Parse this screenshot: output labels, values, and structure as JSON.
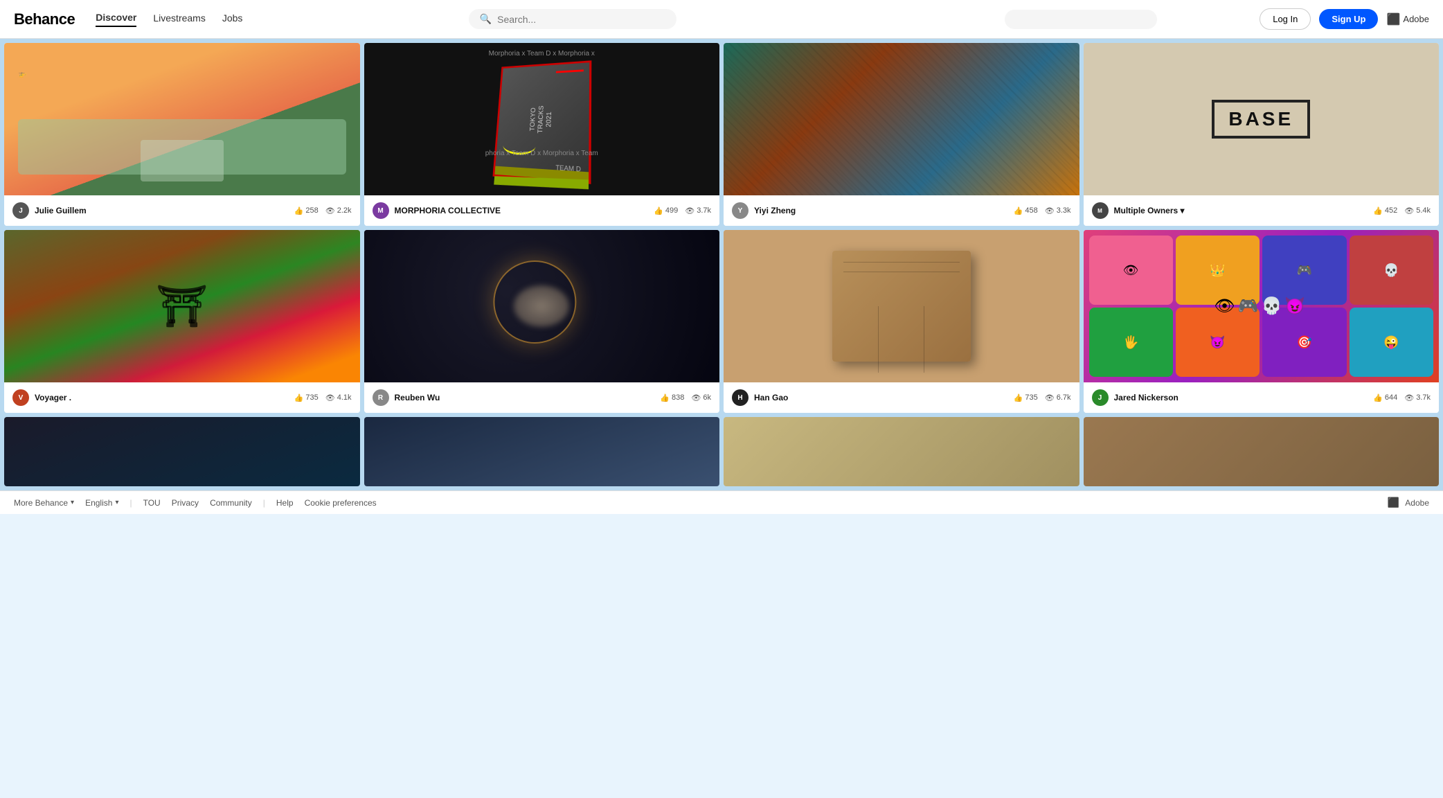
{
  "header": {
    "logo": "Behance",
    "nav": [
      {
        "label": "Discover",
        "active": true
      },
      {
        "label": "Livestreams",
        "active": false
      },
      {
        "label": "Jobs",
        "active": false
      }
    ],
    "search_placeholder": "Search...",
    "login_label": "Log In",
    "signup_label": "Sign Up",
    "adobe_label": "Adobe"
  },
  "grid": {
    "items": [
      {
        "id": 1,
        "author": "Julie Guillem",
        "avatar_color": "#555",
        "avatar_letter": "J",
        "likes": "258",
        "views": "2.2k",
        "img_class": "img-1"
      },
      {
        "id": 2,
        "author": "MORPHORIA COLLECTIVE",
        "avatar_color": "#7a3aa0",
        "avatar_letter": "M",
        "likes": "499",
        "views": "3.7k",
        "img_class": "img-2",
        "has_avatar_img": true
      },
      {
        "id": 3,
        "author": "Yiyi Zheng",
        "avatar_color": "#888",
        "avatar_letter": "Y",
        "likes": "458",
        "views": "3.3k",
        "img_class": "img-3"
      },
      {
        "id": 4,
        "author": "Multiple Owners",
        "avatar_color": "#444",
        "avatar_letter": "M",
        "likes": "452",
        "views": "5.4k",
        "img_class": "img-4",
        "has_dropdown": true
      },
      {
        "id": 5,
        "author": "Voyager .",
        "avatar_color": "#c04020",
        "avatar_letter": "V",
        "likes": "735",
        "views": "4.1k",
        "img_class": "img-5"
      },
      {
        "id": 6,
        "author": "Reuben Wu",
        "avatar_color": "#888",
        "avatar_letter": "R",
        "likes": "838",
        "views": "6k",
        "img_class": "img-6"
      },
      {
        "id": 7,
        "author": "Han Gao",
        "avatar_color": "#222",
        "avatar_letter": "H",
        "likes": "735",
        "views": "6.7k",
        "img_class": "img-7",
        "has_avatar_img": true
      },
      {
        "id": 8,
        "author": "Jared Nickerson",
        "avatar_color": "#2a8a2a",
        "avatar_letter": "J",
        "likes": "644",
        "views": "3.7k",
        "img_class": "img-8"
      },
      {
        "id": 9,
        "author": "",
        "avatar_color": "#444",
        "avatar_letter": "",
        "likes": "",
        "views": "",
        "img_class": "img-9",
        "partial": true
      },
      {
        "id": 10,
        "author": "",
        "avatar_color": "#444",
        "avatar_letter": "",
        "likes": "",
        "views": "",
        "img_class": "img-10",
        "partial": true
      },
      {
        "id": 11,
        "author": "",
        "avatar_color": "#444",
        "avatar_letter": "",
        "likes": "",
        "views": "",
        "img_class": "img-11",
        "partial": true
      },
      {
        "id": 12,
        "author": "",
        "avatar_color": "#444",
        "avatar_letter": "",
        "likes": "",
        "views": "",
        "img_class": "img-12",
        "partial": true
      }
    ]
  },
  "footer": {
    "more_behance_label": "More Behance",
    "language_label": "English",
    "tou_label": "TOU",
    "privacy_label": "Privacy",
    "community_label": "Community",
    "help_label": "Help",
    "cookies_label": "Cookie preferences",
    "adobe_label": "Adobe"
  }
}
